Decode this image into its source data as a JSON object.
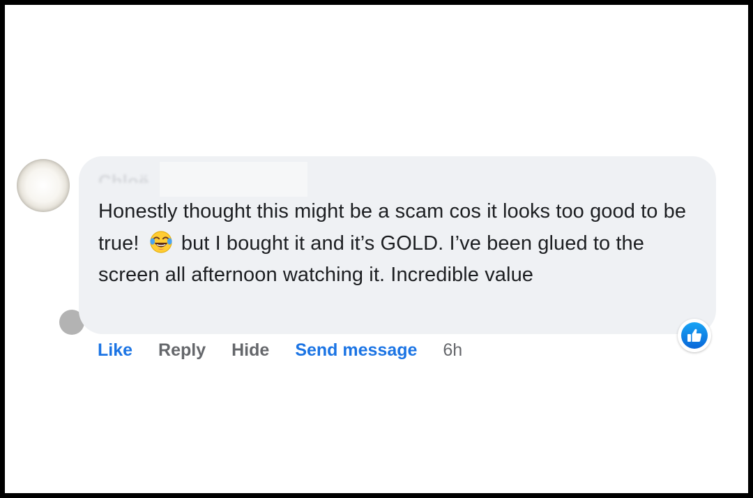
{
  "comment": {
    "author_name": "Chloë",
    "text_part1": "Honestly thought this might be a scam cos it looks too good to be true! ",
    "emoji_name": "face-with-tears-of-joy-icon",
    "text_part2": " but I bought it and it’s GOLD. I’ve been glued to the screen all afternoon watching it. Incredible value"
  },
  "actions": {
    "like_label": "Like",
    "reply_label": "Reply",
    "hide_label": "Hide",
    "send_message_label": "Send message",
    "timestamp": "6h"
  },
  "reaction": {
    "type": "thumbs-up-icon"
  },
  "colors": {
    "accent": "#1b74e4",
    "bubble": "#eff1f4",
    "secondary_text": "#65676b"
  }
}
